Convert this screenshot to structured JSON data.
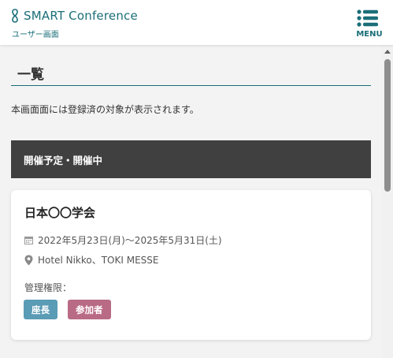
{
  "header": {
    "title": "SMART Conference",
    "subtitle": "ユーザー画面",
    "menu_label": "MENU",
    "logo_icon": "infinity-logo-icon",
    "menu_icon": "list-menu-icon",
    "accent_color": "#1a6e78"
  },
  "page": {
    "title": "一覧",
    "intro": "本画面面には登録済の対象が表示されます。"
  },
  "section": {
    "label": "開催予定・開催中"
  },
  "event": {
    "title": "日本〇〇学会",
    "date": "2022年5月23日(月)～2025年5月31日(土)",
    "venue": "Hotel Nikko、TOKI MESSE",
    "permission_label": "管理権限：",
    "roles": [
      {
        "label": "座長",
        "color": "#5a9bb5"
      },
      {
        "label": "参加者",
        "color": "#b96a84"
      }
    ]
  }
}
